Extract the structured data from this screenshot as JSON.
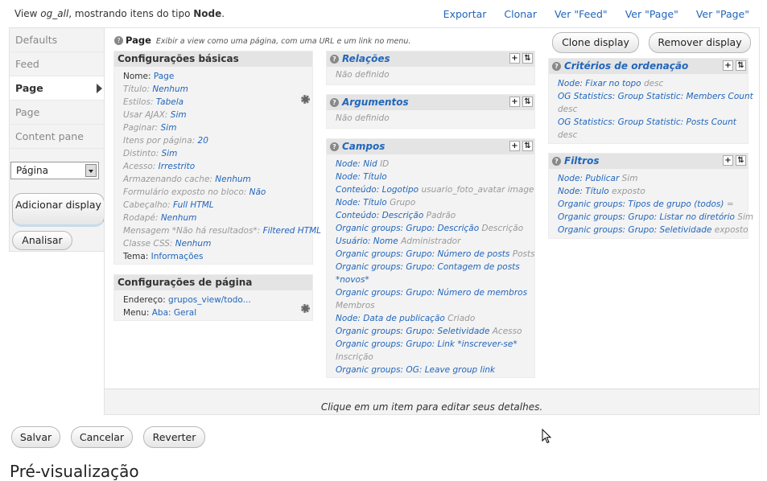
{
  "header": {
    "prefix": "View ",
    "view_name": "og_all",
    "middle": ", mostrando itens do tipo ",
    "type": "Node",
    "period": ".",
    "links": [
      "Exportar",
      "Clonar",
      "Ver \"Feed\"",
      "Ver \"Page\"",
      "Ver \"Page\""
    ]
  },
  "tabs": [
    "Defaults",
    "Feed",
    "Page",
    "Page",
    "Content pane"
  ],
  "display_select": "Página",
  "add_display": "Adicionar display",
  "analyze": "Analisar",
  "panel": {
    "title": "Page",
    "description": "Exibir a view como uma página, com uma URL e um link no menu.",
    "clone": "Clone display",
    "remove": "Remover display",
    "footer_msg": "Clique em um item para editar seus detalhes."
  },
  "basic": {
    "title": "Configurações básicas",
    "rows": [
      {
        "label": "Nome:",
        "value": "Page",
        "override": false
      },
      {
        "label": "Título:",
        "value": "Nenhum",
        "override": true
      },
      {
        "label": "Estilos:",
        "value": "Tabela",
        "override": true
      },
      {
        "label": "Usar AJAX:",
        "value": "Sim",
        "override": true
      },
      {
        "label": "Paginar:",
        "value": "Sim",
        "override": true
      },
      {
        "label": "Itens por página:",
        "value": "20",
        "override": true
      },
      {
        "label": "Distinto:",
        "value": "Sim",
        "override": true
      },
      {
        "label": "Acesso:",
        "value": "Irrestrito",
        "override": true
      },
      {
        "label": "Armazenando cache:",
        "value": "Nenhum",
        "override": true
      },
      {
        "label": "Formulário exposto no bloco:",
        "value": "Não",
        "override": true
      },
      {
        "label": "Cabeçalho:",
        "value": "Full HTML",
        "override": true
      },
      {
        "label": "Rodapé:",
        "value": "Nenhum",
        "override": true
      },
      {
        "label": "Mensagem *Não há resultados*:",
        "value": "Filtered HTML",
        "override": true
      },
      {
        "label": "Classe CSS:",
        "value": "Nenhum",
        "override": true
      },
      {
        "label": "Tema:",
        "value": "Informações",
        "override": false
      }
    ]
  },
  "page_settings": {
    "title": "Configurações de página",
    "rows": [
      {
        "label": "Endereço:",
        "value": "grupos_view/todo..."
      },
      {
        "label": "Menu:",
        "value": "Aba: Geral"
      }
    ]
  },
  "relations": {
    "title": "Relações",
    "empty": "Não definido"
  },
  "arguments": {
    "title": "Argumentos",
    "empty": "Não definido"
  },
  "fields": {
    "title": "Campos",
    "rows": [
      {
        "link": "Node: Nid",
        "gray": "ID"
      },
      {
        "link": "Node: Título",
        "gray": ""
      },
      {
        "link": "Conteúdo: Logotipo",
        "gray": "usuario_foto_avatar image"
      },
      {
        "link": "Node: Título",
        "gray": "Grupo"
      },
      {
        "link": "Conteúdo: Descrição",
        "gray": "Padrão"
      },
      {
        "link": "Organic groups: Grupo: Descrição",
        "gray": "Descrição"
      },
      {
        "link": "Usuário: Nome",
        "gray": "Administrador"
      },
      {
        "link": "Organic groups: Grupo: Número de posts",
        "gray": "Posts"
      },
      {
        "link": "Organic groups: Grupo: Contagem de posts",
        "gray": ""
      },
      {
        "link": "*novos*",
        "gray": ""
      },
      {
        "link": "Organic groups: Grupo: Número de membros",
        "gray": ""
      },
      {
        "link": "",
        "gray": "Membros"
      },
      {
        "link": "Node: Data de publicação",
        "gray": "Criado"
      },
      {
        "link": "Organic groups: Grupo: Seletividade",
        "gray": "Acesso"
      },
      {
        "link": "Organic groups: Grupo: Link *inscrever-se*",
        "gray": ""
      },
      {
        "link": "",
        "gray": "Inscrição"
      },
      {
        "link": "Organic groups: OG: Leave group link",
        "gray": ""
      }
    ]
  },
  "sort": {
    "title": "Critérios de ordenação",
    "rows": [
      {
        "link": "Node: Fixar no topo",
        "gray": "desc"
      },
      {
        "link": "OG Statistics: Group Statistic: Members Count",
        "gray": ""
      },
      {
        "link": "",
        "gray": "desc"
      },
      {
        "link": "OG Statistics: Group Statistic: Posts Count",
        "gray": ""
      },
      {
        "link": "",
        "gray": "desc"
      }
    ]
  },
  "filters": {
    "title": "Filtros",
    "rows": [
      {
        "link": "Node: Publicar",
        "gray": "Sim"
      },
      {
        "link": "Node: Título",
        "gray": "exposto"
      },
      {
        "link": "Organic groups: Tipos de grupo (todos)",
        "gray": "="
      },
      {
        "link": "Organic groups: Grupo: Listar no diretório",
        "gray": "Sim"
      },
      {
        "link": "Organic groups: Grupo: Seletividade",
        "gray": "exposto"
      }
    ]
  },
  "bottom": {
    "save": "Salvar",
    "cancel": "Cancelar",
    "revert": "Reverter",
    "preview": "Pré-visualização"
  }
}
